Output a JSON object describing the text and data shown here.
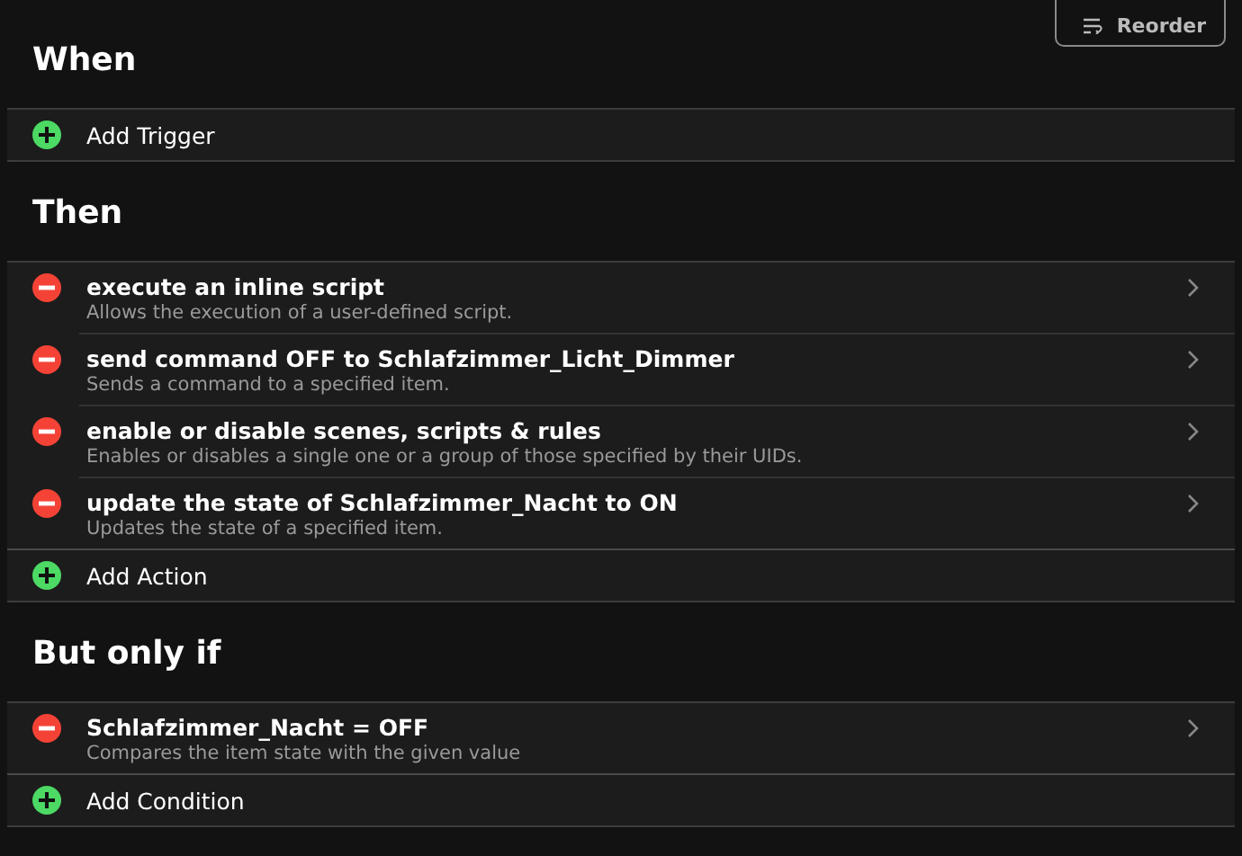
{
  "reorder_button": {
    "label": "Reorder"
  },
  "sections": [
    {
      "title": "When",
      "add_label": "Add Trigger"
    },
    {
      "title": "Then",
      "items": [
        {
          "title": "execute an inline script",
          "description": "Allows the execution of a user-defined script."
        },
        {
          "title": "send command OFF to Schlafzimmer_Licht_Dimmer",
          "description": "Sends a command to a specified item."
        },
        {
          "title": "enable or disable scenes, scripts & rules",
          "description": "Enables or disables a single one or a group of those specified by their UIDs."
        },
        {
          "title": "update the state of Schlafzimmer_Nacht to ON",
          "description": "Updates the state of a specified item."
        }
      ],
      "add_label": "Add Action"
    },
    {
      "title": "But only if",
      "items": [
        {
          "title": "Schlafzimmer_Nacht = OFF",
          "description": "Compares the item state with the given value"
        }
      ],
      "add_label": "Add Condition"
    }
  ]
}
